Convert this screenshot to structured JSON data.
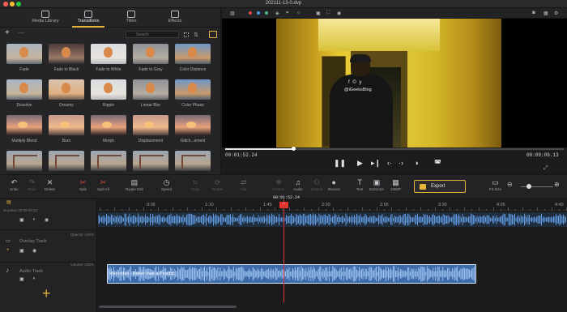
{
  "window": {
    "title": "202111-13-0.dvp"
  },
  "library": {
    "tabs": [
      {
        "label": "Media Library",
        "active": false
      },
      {
        "label": "Transitions",
        "active": true
      },
      {
        "label": "Titles",
        "active": false
      },
      {
        "label": "Effects",
        "active": false
      }
    ],
    "search_placeholder": "Search",
    "transitions": [
      {
        "label": "Fade",
        "theme": "sky1"
      },
      {
        "label": "Fade to Black",
        "theme": "sky2"
      },
      {
        "label": "Fade to White",
        "theme": "sky3"
      },
      {
        "label": "Fade to Gray",
        "theme": "sky4"
      },
      {
        "label": "Color Distance",
        "theme": "sky5"
      },
      {
        "label": "Dissolve",
        "theme": "sky1"
      },
      {
        "label": "Dreamy",
        "theme": "sky6"
      },
      {
        "label": "Ripple",
        "theme": "sky3"
      },
      {
        "label": "Linear Blur",
        "theme": "sky4"
      },
      {
        "label": "Color Phase",
        "theme": "sky5"
      },
      {
        "label": "Multiply Blend",
        "theme": "sun1"
      },
      {
        "label": "Burn",
        "theme": "sun2"
      },
      {
        "label": "Morph",
        "theme": "sun1"
      },
      {
        "label": "Displacement",
        "theme": "sun2"
      },
      {
        "label": "Glitch...ement",
        "theme": "sun1"
      },
      {
        "label": "",
        "theme": "bridge"
      },
      {
        "label": "",
        "theme": "bridge"
      },
      {
        "label": "",
        "theme": "bridge"
      },
      {
        "label": "",
        "theme": "bridge"
      },
      {
        "label": "",
        "theme": "bridge"
      }
    ]
  },
  "preview": {
    "shirt_logo": "f © y",
    "shirt_text": "@iGeeksBlog",
    "current_time": "00:01:52.24",
    "total_time": "00:09:09.13",
    "progress": 0.2
  },
  "toolbar": {
    "tools": [
      {
        "label": "Undo",
        "icon": "↶",
        "state": "normal"
      },
      {
        "label": "Redo",
        "icon": "↷",
        "state": "dim"
      },
      {
        "label": "Delete",
        "icon": "✕",
        "state": "normal"
      },
      {
        "label": "Split",
        "icon": "✂",
        "state": "red"
      },
      {
        "label": "Split All",
        "icon": "✂",
        "state": "red"
      },
      {
        "label": "Ripple Edit",
        "icon": "▤",
        "state": "normal"
      },
      {
        "label": "Speed",
        "icon": "◷",
        "state": "normal"
      },
      {
        "label": "Crop",
        "icon": "⌗",
        "state": "dim"
      },
      {
        "label": "Rotate",
        "icon": "⟳",
        "state": "dim"
      },
      {
        "label": "Flip",
        "icon": "⇄",
        "state": "dim"
      },
      {
        "label": "Freeze",
        "icon": "❄",
        "state": "dim"
      },
      {
        "label": "Audio",
        "icon": "♫",
        "state": "normal"
      },
      {
        "label": "Detach",
        "icon": "⭘",
        "state": "dim"
      },
      {
        "label": "Record",
        "icon": "●",
        "state": "normal"
      },
      {
        "label": "Text",
        "icon": "T",
        "state": "normal"
      },
      {
        "label": "Extractor",
        "icon": "▣",
        "state": "normal"
      },
      {
        "label": "1080P",
        "icon": "▦",
        "state": "normal"
      },
      {
        "label": "Fit Size",
        "icon": "▭",
        "state": "normal"
      }
    ],
    "export_label": "Export"
  },
  "timeline": {
    "duration": "Duration 00:09:09:13",
    "ruler": [
      "0:36",
      "1:10",
      "1:45",
      "2:20",
      "2:55",
      "3:30",
      "4:05",
      "4:40"
    ],
    "playhead_time": "00:01:52.24",
    "overlay_track": {
      "name": "Overlay Track",
      "opacity": "Opacity: 100%"
    },
    "audio_track": {
      "name": "Audio Track",
      "volume": "Volume: 100%"
    },
    "clip_label": "Mercedes - Better than a Psychic"
  }
}
